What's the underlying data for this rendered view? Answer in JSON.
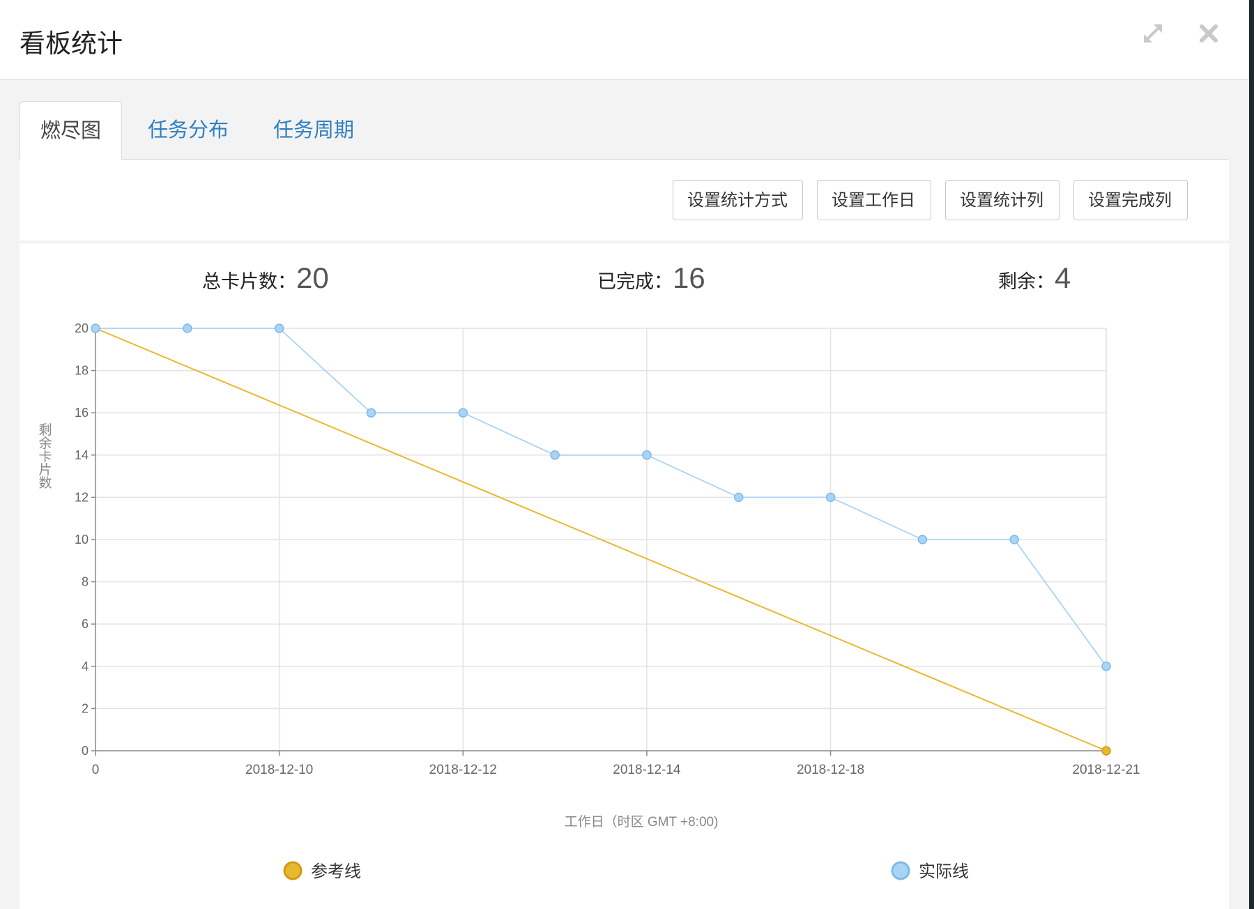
{
  "dialog": {
    "title": "看板统计",
    "expand_icon": "expand-icon",
    "close_icon": "close-icon"
  },
  "tabs": [
    {
      "label": "燃尽图",
      "active": true
    },
    {
      "label": "任务分布",
      "active": false
    },
    {
      "label": "任务周期",
      "active": false
    }
  ],
  "toolbar": {
    "set_method_label": "设置统计方式",
    "set_workday_label": "设置工作日",
    "set_columns_label": "设置统计列",
    "set_done_label": "设置完成列"
  },
  "stats": {
    "total_label": "总卡片数：",
    "total_value": "20",
    "done_label": "已完成：",
    "done_value": "16",
    "remaining_label": "剩余：",
    "remaining_value": "4"
  },
  "colors": {
    "reference": "#e8b830",
    "actual": "#a9d4f5",
    "grid": "#e3e3e3",
    "axis": "#888888"
  },
  "chart_data": {
    "type": "line",
    "ylabel": "剩余卡片数",
    "xlabel": "工作日（时区 GMT +8:00)",
    "ylim": [
      0,
      20
    ],
    "yticks": [
      0,
      2,
      4,
      6,
      8,
      10,
      12,
      14,
      16,
      18,
      20
    ],
    "x_index_range": [
      0,
      11
    ],
    "x_tick_labels": [
      {
        "index": 0,
        "label": "0"
      },
      {
        "index": 2,
        "label": "2018-12-10"
      },
      {
        "index": 4,
        "label": "2018-12-12"
      },
      {
        "index": 6,
        "label": "2018-12-14"
      },
      {
        "index": 8,
        "label": "2018-12-18"
      },
      {
        "index": 11,
        "label": "2018-12-21"
      }
    ],
    "grid": true,
    "legend_placement": "bottom",
    "series": [
      {
        "name": "参考线",
        "points": [
          {
            "x": 0,
            "y": 20
          },
          {
            "x": 11,
            "y": 0
          }
        ],
        "markers": [
          {
            "x": 11,
            "y": 0
          }
        ]
      },
      {
        "name": "实际线",
        "points": [
          {
            "x": 0,
            "y": 20
          },
          {
            "x": 1,
            "y": 20
          },
          {
            "x": 2,
            "y": 20
          },
          {
            "x": 3,
            "y": 16
          },
          {
            "x": 4,
            "y": 16
          },
          {
            "x": 5,
            "y": 14
          },
          {
            "x": 6,
            "y": 14
          },
          {
            "x": 7,
            "y": 12
          },
          {
            "x": 8,
            "y": 12
          },
          {
            "x": 9,
            "y": 10
          },
          {
            "x": 10,
            "y": 10
          },
          {
            "x": 11,
            "y": 4
          }
        ]
      }
    ]
  }
}
